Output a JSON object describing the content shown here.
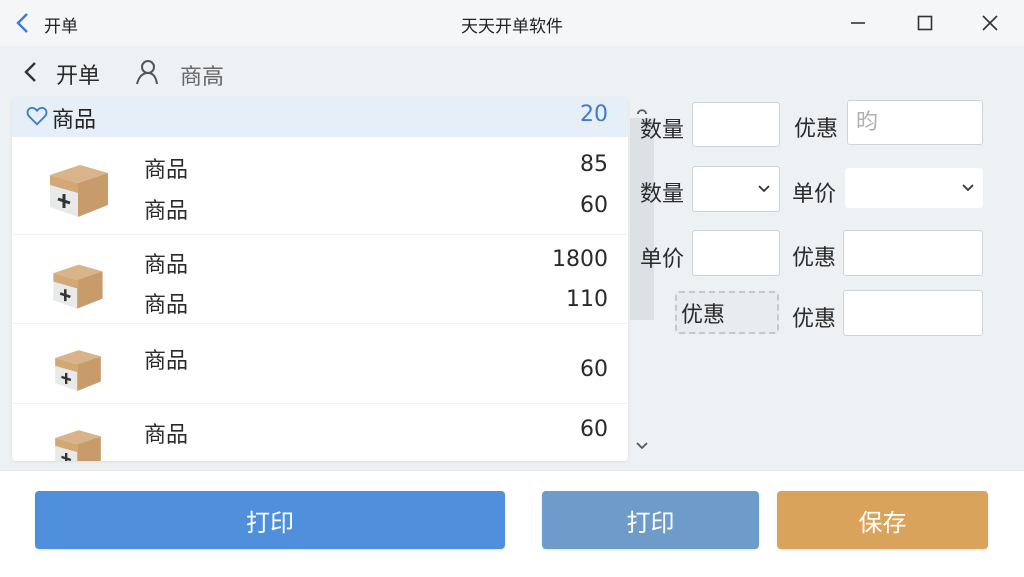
{
  "window": {
    "left_title": "开单",
    "title": "天天开单软件"
  },
  "nav": {
    "back_label": "开单",
    "user_label": "商高"
  },
  "list": {
    "header_label": "商品",
    "header_count": "20",
    "rows": [
      {
        "name": "商品",
        "value": "85"
      },
      {
        "name": "商品",
        "value": "60"
      },
      {
        "name": "商品",
        "value": "1800"
      },
      {
        "name": "商品",
        "value": "110"
      },
      {
        "name": "商品",
        "value": "60"
      },
      {
        "name": "商品",
        "value": "60"
      }
    ]
  },
  "form": {
    "qty1_label": "数量",
    "discount1_label": "优惠",
    "discount1_placeholder": "昀",
    "qty2_label": "数量",
    "unit_price1_label": "单价",
    "unit_price2_label": "单价",
    "discount2_label": "优惠",
    "discount_button_label": "优惠",
    "discount3_label": "优惠"
  },
  "footer": {
    "print_primary": "打印",
    "print_secondary": "打印",
    "save": "保存"
  },
  "colors": {
    "accent": "#4f8fdc",
    "print_secondary": "#6f9bcb",
    "save": "#d9a35c",
    "header_count": "#3f7dc6"
  }
}
